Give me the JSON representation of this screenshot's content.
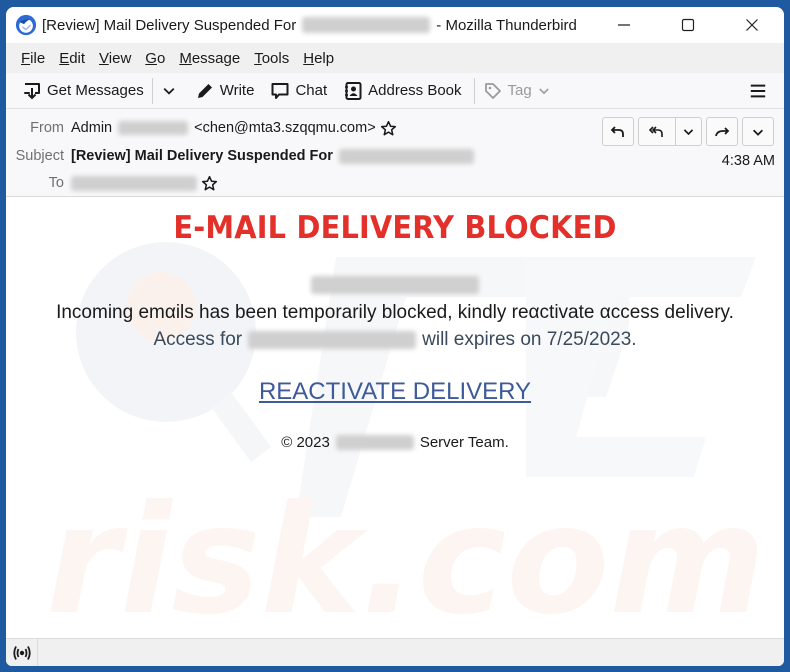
{
  "window": {
    "title_prefix": "[Review] Mail Delivery Suspended For",
    "title_suffix": "- Mozilla Thunderbird",
    "controls": [
      "minimize",
      "maximize",
      "close"
    ]
  },
  "menubar": {
    "items": [
      {
        "label": "File",
        "accel": "F",
        "rest": "ile"
      },
      {
        "label": "Edit",
        "accel": "E",
        "rest": "dit"
      },
      {
        "label": "View",
        "accel": "V",
        "rest": "iew"
      },
      {
        "label": "Go",
        "accel": "G",
        "rest": "o"
      },
      {
        "label": "Message",
        "accel": "M",
        "rest": "essage"
      },
      {
        "label": "Tools",
        "accel": "T",
        "rest": "ools"
      },
      {
        "label": "Help",
        "accel": "H",
        "rest": "elp"
      }
    ]
  },
  "toolbar": {
    "get_messages": "Get Messages",
    "write": "Write",
    "chat": "Chat",
    "address_book": "Address Book",
    "tag": "Tag"
  },
  "headers": {
    "from_label": "From",
    "from_name": "Admin",
    "from_email": "<chen@mta3.szqqmu.com>",
    "subject_label": "Subject",
    "subject": "[Review] Mail Delivery Suspended For",
    "to_label": "To",
    "time": "4:38 AM",
    "actions": [
      "reply",
      "reply-all",
      "reply-all-menu",
      "forward",
      "more"
    ]
  },
  "message": {
    "title": "E-MAIL DELIVERY BLOCKED",
    "line1": "Incoming emαils has been temporarily blocked, kindly reαctivate αccess delivery.",
    "line2_prefix": "Access for",
    "line2_suffix": "will expires on 7/25/2023.",
    "cta": "REACTIVATE DELIVERY",
    "footer_prefix": "© 2023",
    "footer_suffix": "Server Team.",
    "colors": {
      "title": "#e3302a",
      "link": "#3e5a9a"
    }
  },
  "statusbar": {
    "icon": "online-status-icon"
  }
}
